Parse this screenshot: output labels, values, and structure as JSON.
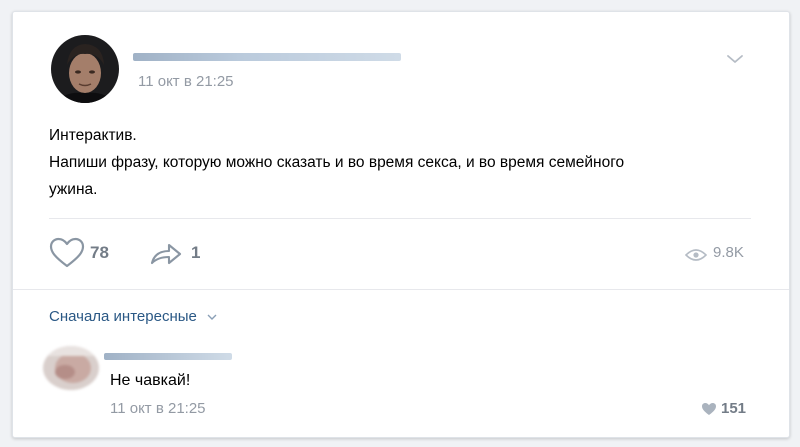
{
  "post": {
    "time": "11 окт в 21:25",
    "text_line1": "Интерактив.",
    "text_line2": "Напиши фразу, которую можно сказать и во время секса, и во время семейного",
    "text_line3": "ужина.",
    "likes": "78",
    "shares": "1",
    "views": "9.8K"
  },
  "comments": {
    "sort_label": "Сначала интересные",
    "items": [
      {
        "text": "Не чавкай!",
        "time": "11 окт в 21:25",
        "likes": "151"
      }
    ]
  },
  "icons": {
    "like": "heart-icon",
    "share": "share-arrow-icon",
    "views": "eye-icon",
    "menu": "chevron-down-icon"
  },
  "colors": {
    "link": "#2a5885",
    "muted": "#939aa4",
    "icon": "#8a96a3"
  }
}
